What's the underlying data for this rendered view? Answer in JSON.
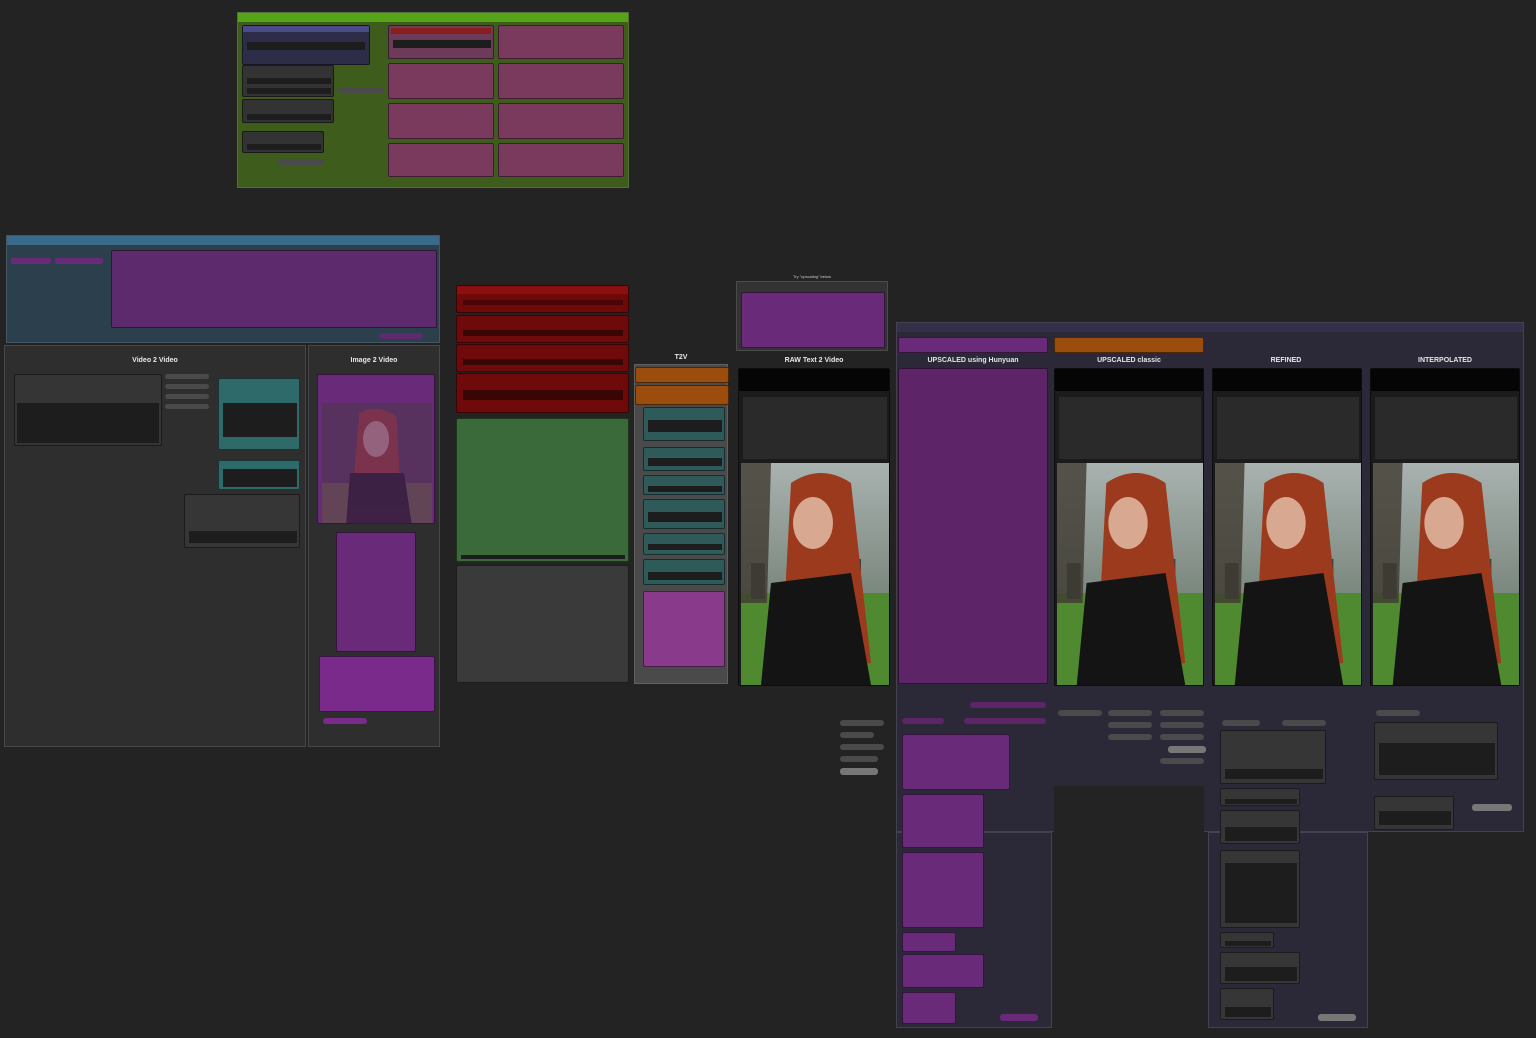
{
  "groups": {
    "v2v_title": "Video 2 Video",
    "i2v_title": "Image 2 Video",
    "t2v_title": "T2V",
    "raw_note": "Try \"upscaling\" below",
    "raw_title": "RAW Text 2 Video",
    "upscaled_hunyuan_title": "UPSCALED using Hunyuan",
    "upscaled_classic_title": "UPSCALED classic",
    "refined_title": "REFINED",
    "interpolated_title": "INTERPOLATED"
  },
  "colors": {
    "canvas_bg": "#232323",
    "green_group": "#3e5d1c",
    "blue_group": "#2c3f4d",
    "purple_node": "#5a2468",
    "red_node": "#6e0a0a",
    "teal_node": "#2e5a5a",
    "orange_node": "#9a4d0c",
    "dark_group": "#2b2838"
  },
  "icons": {
    "preview": "photo-preview-icon",
    "dot": "connection-dot-icon"
  }
}
